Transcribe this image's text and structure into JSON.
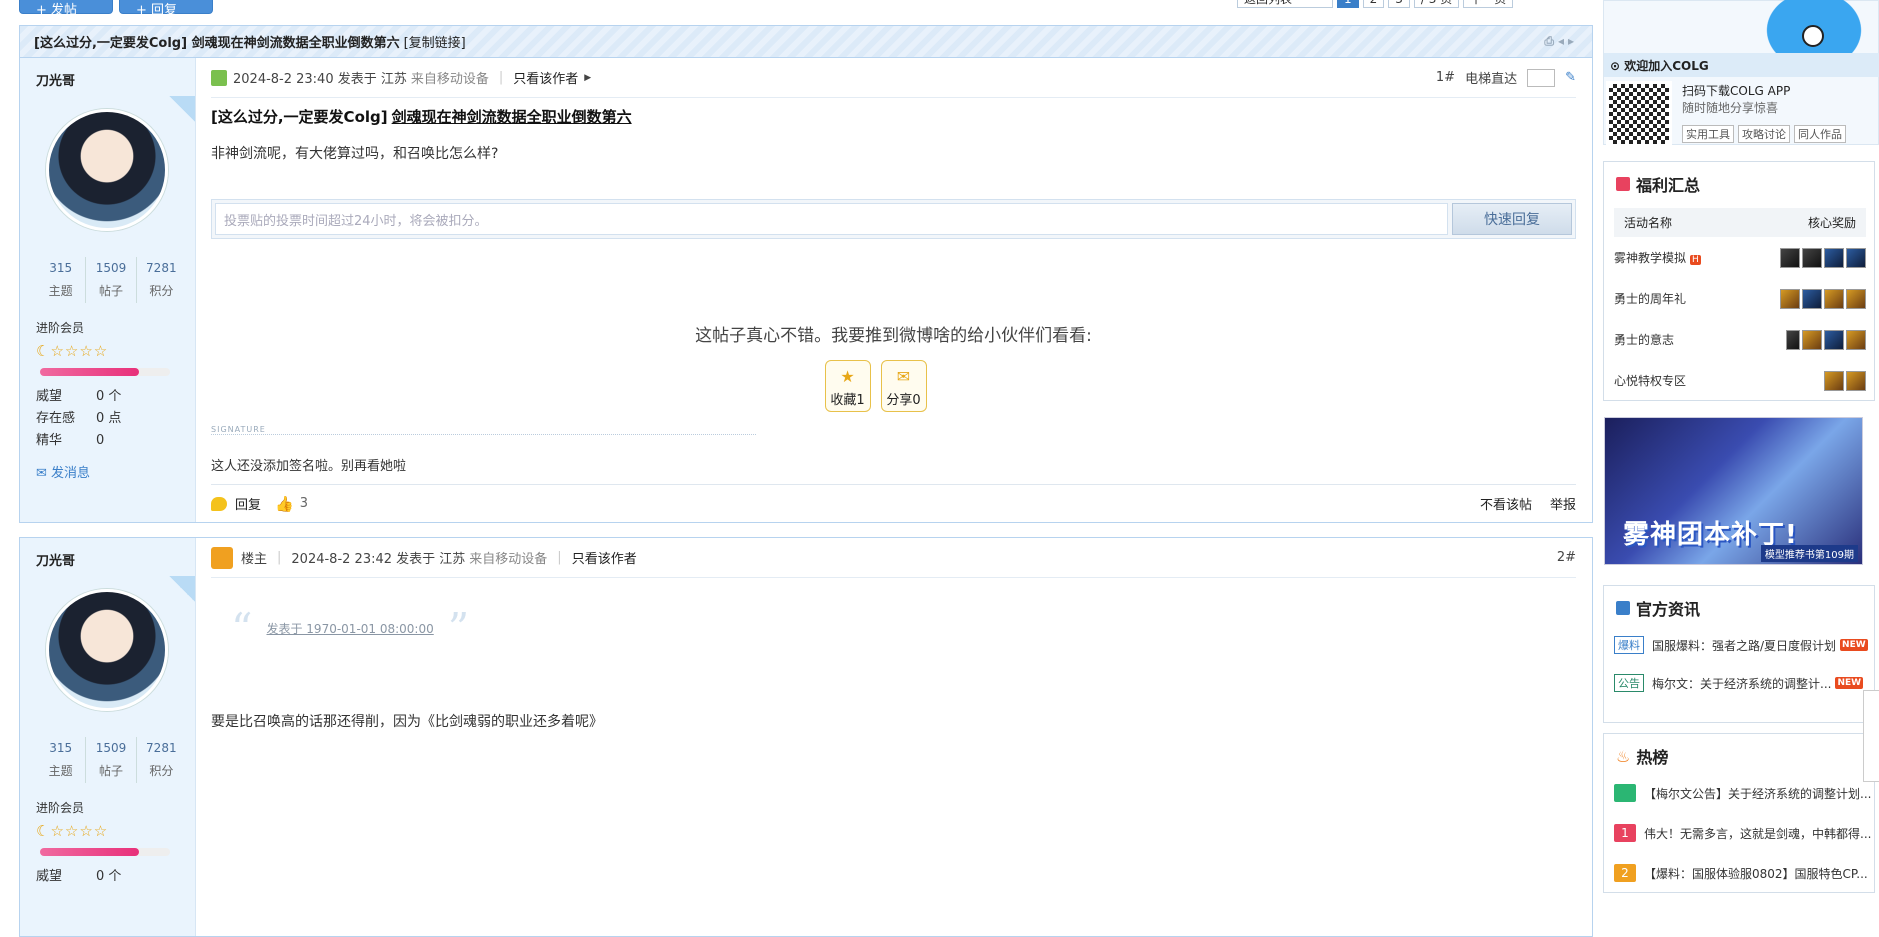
{
  "topbar": {
    "btn1": "+ 发帖",
    "btn2": "+ 回复",
    "back": "返回列表",
    "pages": [
      "1",
      "2",
      "3"
    ],
    "total": "/ 3 页",
    "next": "下一页"
  },
  "thread": {
    "title": "[这么过分,一定要发Colg] 剑魂现在神剑流数据全职业倒数第六",
    "copy_link": "[复制链接]"
  },
  "post1": {
    "author": "刀光哥",
    "stats": [
      {
        "value": "315",
        "label": "主题"
      },
      {
        "value": "1509",
        "label": "帖子"
      },
      {
        "value": "7281",
        "label": "积分"
      }
    ],
    "level": "进阶会员",
    "stars": "☾☆☆☆☆",
    "weiwang_label": "威望",
    "weiwang": "0 个",
    "cunzai_label": "存在感",
    "cunzai": "0 点",
    "jinghua_label": "精华",
    "jinghua": "0",
    "send_msg": "发消息",
    "time": "2024-8-2 23:40 发表于 江苏",
    "device": "来自移动设备",
    "only_author": "只看该作者",
    "floor": "1#",
    "elevator": "电梯直达",
    "title_prefix": "[这么过分,一定要发Colg]",
    "title_link": "剑魂现在神剑流数据全职业倒数第六",
    "body": "非神剑流呢，有大佬算过吗，和召唤比怎么样?",
    "reply_placeholder": "投票贴的投票时间超过24小时，将会被扣分。",
    "quick_reply": "快速回复",
    "recommend": "这帖子真心不错。我要推到微博啥的给小伙伴们看看:",
    "fav": "收藏1",
    "share": "分享0",
    "sig_label": "SIGNATURE",
    "sig": "这人还没添加签名啦。别再看她啦",
    "reply": "回复",
    "likes": "3",
    "ignore": "不看该帖",
    "report": "举报"
  },
  "post2": {
    "author": "刀光哥",
    "stats": [
      {
        "value": "315",
        "label": "主题"
      },
      {
        "value": "1509",
        "label": "帖子"
      },
      {
        "value": "7281",
        "label": "积分"
      }
    ],
    "level": "进阶会员",
    "stars": "☾☆☆☆☆",
    "weiwang_label": "威望",
    "weiwang": "0 个",
    "host": "楼主",
    "time": "2024-8-2 23:42 发表于 江苏",
    "device": "来自移动设备",
    "only_author": "只看该作者",
    "floor": "2#",
    "quote": "发表于 1970-01-01 08:00:00",
    "body": "要是比召唤高的话那还得削，因为《比剑魂弱的职业还多着呢》"
  },
  "sidebar": {
    "join": "欢迎加入COLG",
    "app_title": "扫码下载COLG APP",
    "app_sub": "随时随地分享惊喜",
    "tags": [
      "实用工具",
      "攻略讨论",
      "同人作品"
    ],
    "fuli_title": "福利汇总",
    "col1": "活动名称",
    "col2": "核心奖励",
    "fuli": [
      {
        "name": "雾神教学模拟",
        "hot": "H"
      },
      {
        "name": "勇士的周年礼",
        "hot": ""
      },
      {
        "name": "勇士的意志",
        "hot": ""
      },
      {
        "name": "心悦特权专区",
        "hot": ""
      }
    ],
    "banner_title": "雾神团本补丁!",
    "banner_sub": "模型推荐书第109期",
    "news_title": "官方资讯",
    "news": [
      {
        "tag": "爆料",
        "text": "国服爆料：强者之路/夏日度假计划",
        "badge": "NEW"
      },
      {
        "tag": "公告",
        "text": "梅尔文：关于经济系统的调整计...",
        "badge": "NEW"
      }
    ],
    "hot_title": "热榜",
    "hot": [
      {
        "n": "",
        "text": "【梅尔文公告】关于经济系统的调整计划..."
      },
      {
        "n": "1",
        "text": "伟大！无需多言，这就是剑魂，中韩都得..."
      },
      {
        "n": "2",
        "text": "【爆料：国服体验服0802】国服特色CP..."
      }
    ]
  }
}
